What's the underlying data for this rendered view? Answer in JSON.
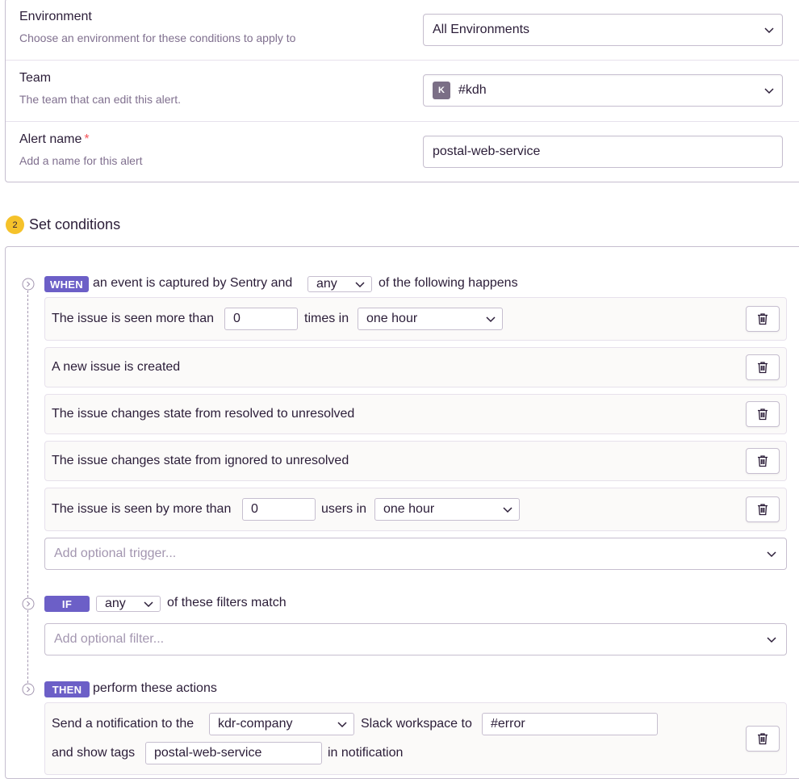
{
  "settings": {
    "environment": {
      "title": "Environment",
      "subtitle": "Choose an environment for these conditions to apply to",
      "value": "All Environments"
    },
    "team": {
      "title": "Team",
      "subtitle": "The team that can edit this alert.",
      "badge": "K",
      "value": "#kdh"
    },
    "alert_name": {
      "title": "Alert name",
      "required_mark": "*",
      "subtitle": "Add a name for this alert",
      "value": "postal-web-service"
    }
  },
  "step": {
    "number": "2",
    "title": "Set conditions"
  },
  "when": {
    "tag": "WHEN",
    "text_before": "an event is captured by Sentry and",
    "match": "any",
    "text_after": "of the following happens",
    "conditions": {
      "c1": {
        "prefix": "The issue is seen more than",
        "value": "0",
        "middle": "times in",
        "interval": "one hour"
      },
      "c2": {
        "text": "A new issue is created"
      },
      "c3": {
        "text": "The issue changes state from resolved to unresolved"
      },
      "c4": {
        "text": "The issue changes state from ignored to unresolved"
      },
      "c5": {
        "prefix": "The issue is seen by more than",
        "value": "0",
        "middle": "users in",
        "interval": "one hour"
      }
    },
    "add_placeholder": "Add optional trigger..."
  },
  "if": {
    "tag": "IF",
    "match": "any",
    "text_after": "of these filters match",
    "add_placeholder": "Add optional filter..."
  },
  "then": {
    "tag": "THEN",
    "text_after": "perform these actions",
    "action": {
      "prefix": "Send a notification to the",
      "workspace": "kdr-company",
      "middle": "Slack workspace to",
      "channel": "#error",
      "tags_prefix": "and show tags",
      "tags": "postal-web-service",
      "tags_suffix": "in notification"
    }
  },
  "colors": {
    "accent": "#6c5fc7",
    "step_badge": "#f5c22a",
    "border": "#c6becf",
    "muted": "#80708f"
  }
}
